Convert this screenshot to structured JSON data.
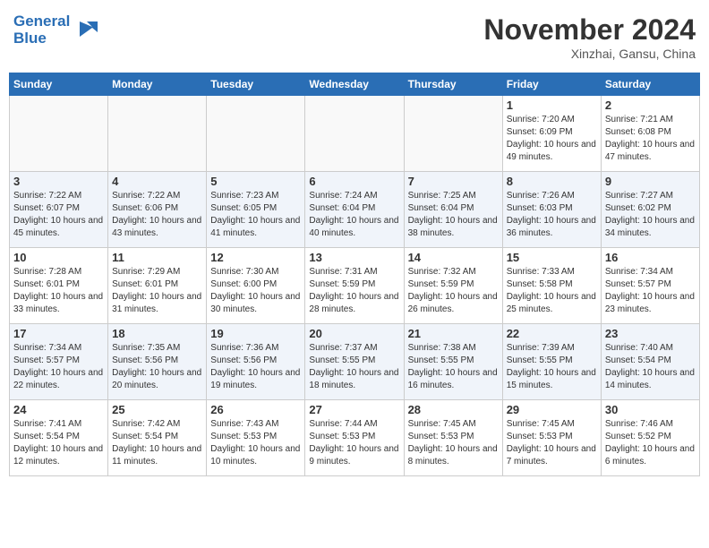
{
  "header": {
    "logo_line1": "General",
    "logo_line2": "Blue",
    "month": "November 2024",
    "location": "Xinzhai, Gansu, China"
  },
  "days_of_week": [
    "Sunday",
    "Monday",
    "Tuesday",
    "Wednesday",
    "Thursday",
    "Friday",
    "Saturday"
  ],
  "weeks": [
    [
      {
        "day": "",
        "info": ""
      },
      {
        "day": "",
        "info": ""
      },
      {
        "day": "",
        "info": ""
      },
      {
        "day": "",
        "info": ""
      },
      {
        "day": "",
        "info": ""
      },
      {
        "day": "1",
        "info": "Sunrise: 7:20 AM\nSunset: 6:09 PM\nDaylight: 10 hours and 49 minutes."
      },
      {
        "day": "2",
        "info": "Sunrise: 7:21 AM\nSunset: 6:08 PM\nDaylight: 10 hours and 47 minutes."
      }
    ],
    [
      {
        "day": "3",
        "info": "Sunrise: 7:22 AM\nSunset: 6:07 PM\nDaylight: 10 hours and 45 minutes."
      },
      {
        "day": "4",
        "info": "Sunrise: 7:22 AM\nSunset: 6:06 PM\nDaylight: 10 hours and 43 minutes."
      },
      {
        "day": "5",
        "info": "Sunrise: 7:23 AM\nSunset: 6:05 PM\nDaylight: 10 hours and 41 minutes."
      },
      {
        "day": "6",
        "info": "Sunrise: 7:24 AM\nSunset: 6:04 PM\nDaylight: 10 hours and 40 minutes."
      },
      {
        "day": "7",
        "info": "Sunrise: 7:25 AM\nSunset: 6:04 PM\nDaylight: 10 hours and 38 minutes."
      },
      {
        "day": "8",
        "info": "Sunrise: 7:26 AM\nSunset: 6:03 PM\nDaylight: 10 hours and 36 minutes."
      },
      {
        "day": "9",
        "info": "Sunrise: 7:27 AM\nSunset: 6:02 PM\nDaylight: 10 hours and 34 minutes."
      }
    ],
    [
      {
        "day": "10",
        "info": "Sunrise: 7:28 AM\nSunset: 6:01 PM\nDaylight: 10 hours and 33 minutes."
      },
      {
        "day": "11",
        "info": "Sunrise: 7:29 AM\nSunset: 6:01 PM\nDaylight: 10 hours and 31 minutes."
      },
      {
        "day": "12",
        "info": "Sunrise: 7:30 AM\nSunset: 6:00 PM\nDaylight: 10 hours and 30 minutes."
      },
      {
        "day": "13",
        "info": "Sunrise: 7:31 AM\nSunset: 5:59 PM\nDaylight: 10 hours and 28 minutes."
      },
      {
        "day": "14",
        "info": "Sunrise: 7:32 AM\nSunset: 5:59 PM\nDaylight: 10 hours and 26 minutes."
      },
      {
        "day": "15",
        "info": "Sunrise: 7:33 AM\nSunset: 5:58 PM\nDaylight: 10 hours and 25 minutes."
      },
      {
        "day": "16",
        "info": "Sunrise: 7:34 AM\nSunset: 5:57 PM\nDaylight: 10 hours and 23 minutes."
      }
    ],
    [
      {
        "day": "17",
        "info": "Sunrise: 7:34 AM\nSunset: 5:57 PM\nDaylight: 10 hours and 22 minutes."
      },
      {
        "day": "18",
        "info": "Sunrise: 7:35 AM\nSunset: 5:56 PM\nDaylight: 10 hours and 20 minutes."
      },
      {
        "day": "19",
        "info": "Sunrise: 7:36 AM\nSunset: 5:56 PM\nDaylight: 10 hours and 19 minutes."
      },
      {
        "day": "20",
        "info": "Sunrise: 7:37 AM\nSunset: 5:55 PM\nDaylight: 10 hours and 18 minutes."
      },
      {
        "day": "21",
        "info": "Sunrise: 7:38 AM\nSunset: 5:55 PM\nDaylight: 10 hours and 16 minutes."
      },
      {
        "day": "22",
        "info": "Sunrise: 7:39 AM\nSunset: 5:55 PM\nDaylight: 10 hours and 15 minutes."
      },
      {
        "day": "23",
        "info": "Sunrise: 7:40 AM\nSunset: 5:54 PM\nDaylight: 10 hours and 14 minutes."
      }
    ],
    [
      {
        "day": "24",
        "info": "Sunrise: 7:41 AM\nSunset: 5:54 PM\nDaylight: 10 hours and 12 minutes."
      },
      {
        "day": "25",
        "info": "Sunrise: 7:42 AM\nSunset: 5:54 PM\nDaylight: 10 hours and 11 minutes."
      },
      {
        "day": "26",
        "info": "Sunrise: 7:43 AM\nSunset: 5:53 PM\nDaylight: 10 hours and 10 minutes."
      },
      {
        "day": "27",
        "info": "Sunrise: 7:44 AM\nSunset: 5:53 PM\nDaylight: 10 hours and 9 minutes."
      },
      {
        "day": "28",
        "info": "Sunrise: 7:45 AM\nSunset: 5:53 PM\nDaylight: 10 hours and 8 minutes."
      },
      {
        "day": "29",
        "info": "Sunrise: 7:45 AM\nSunset: 5:53 PM\nDaylight: 10 hours and 7 minutes."
      },
      {
        "day": "30",
        "info": "Sunrise: 7:46 AM\nSunset: 5:52 PM\nDaylight: 10 hours and 6 minutes."
      }
    ]
  ]
}
